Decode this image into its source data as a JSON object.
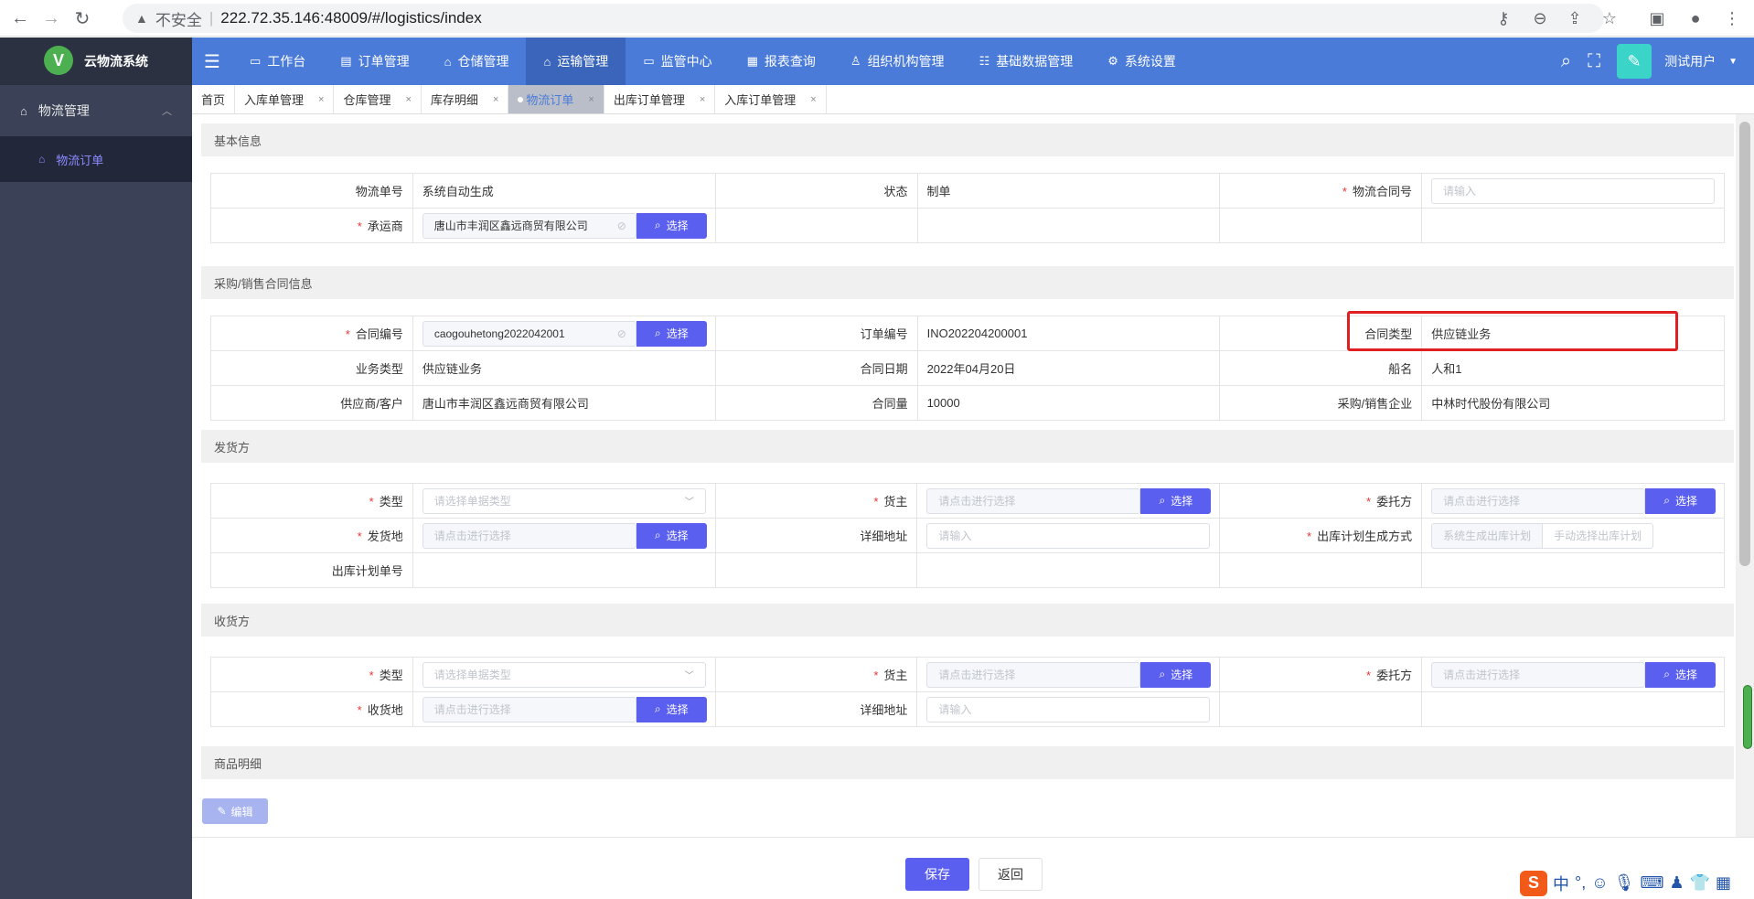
{
  "browser": {
    "security_label": "不安全",
    "url": "222.72.35.146:48009/#/logistics/index"
  },
  "sidebar": {
    "logo_letter": "V",
    "app_name": "云物流系统",
    "group_label": "物流管理",
    "sub_label": "物流订单"
  },
  "topnav": {
    "items": [
      {
        "label": "工作台",
        "icon": "monitor-icon"
      },
      {
        "label": "订单管理",
        "icon": "document-icon"
      },
      {
        "label": "仓储管理",
        "icon": "home-icon"
      },
      {
        "label": "运输管理",
        "icon": "home-icon"
      },
      {
        "label": "监管中心",
        "icon": "monitor-icon"
      },
      {
        "label": "报表查询",
        "icon": "chart-icon"
      },
      {
        "label": "组织机构管理",
        "icon": "org-icon"
      },
      {
        "label": "基础数据管理",
        "icon": "list-icon"
      },
      {
        "label": "系统设置",
        "icon": "gear-icon"
      }
    ],
    "user_name": "测试用户"
  },
  "tabs": [
    {
      "label": "首页",
      "closable": false
    },
    {
      "label": "入库单管理",
      "closable": true
    },
    {
      "label": "仓库管理",
      "closable": true
    },
    {
      "label": "库存明细",
      "closable": true
    },
    {
      "label": "物流订单",
      "closable": true,
      "active": true
    },
    {
      "label": "出库订单管理",
      "closable": true
    },
    {
      "label": "入库订单管理",
      "closable": true
    }
  ],
  "sections": {
    "basic": "基本信息",
    "contract": "采购/销售合同信息",
    "shipper": "发货方",
    "receiver": "收货方",
    "goods": "商品明细"
  },
  "basic": {
    "order_no_label": "物流单号",
    "order_no_value": "系统自动生成",
    "status_label": "状态",
    "status_value": "制单",
    "contract_no_label": "物流合同号",
    "contract_no_placeholder": "请输入",
    "carrier_label": "承运商",
    "carrier_value": "唐山市丰润区鑫远商贸有限公司"
  },
  "contract": {
    "contract_code_label": "合同编号",
    "contract_code_value": "caogouhetong2022042001",
    "order_code_label": "订单编号",
    "order_code_value": "INO202204200001",
    "contract_type_label": "合同类型",
    "contract_type_value": "供应链业务",
    "biz_type_label": "业务类型",
    "biz_type_value": "供应链业务",
    "contract_date_label": "合同日期",
    "contract_date_value": "2022年04月20日",
    "ship_name_label": "船名",
    "ship_name_value": "人和1",
    "supplier_label": "供应商/客户",
    "supplier_value": "唐山市丰润区鑫远商贸有限公司",
    "quantity_label": "合同量",
    "quantity_value": "10000",
    "company_label": "采购/销售企业",
    "company_value": "中林时代股份有限公司"
  },
  "shipper": {
    "type_label": "类型",
    "type_placeholder": "请选择单据类型",
    "owner_label": "货主",
    "owner_placeholder": "请点击进行选择",
    "client_label": "委托方",
    "client_placeholder": "请点击进行选择",
    "origin_label": "发货地",
    "origin_placeholder": "请点击进行选择",
    "address_label": "详细地址",
    "address_placeholder": "请输入",
    "plan_mode_label": "出库计划生成方式",
    "plan_mode_options": [
      "系统生成出库计划",
      "手动选择出库计划"
    ],
    "plan_no_label": "出库计划单号"
  },
  "receiver": {
    "type_label": "类型",
    "type_placeholder": "请选择单据类型",
    "owner_label": "货主",
    "owner_placeholder": "请点击进行选择",
    "client_label": "委托方",
    "client_placeholder": "请点击进行选择",
    "dest_label": "收货地",
    "dest_placeholder": "请点击进行选择",
    "address_label": "详细地址",
    "address_placeholder": "请输入"
  },
  "buttons": {
    "select": "选择",
    "edit": "编辑",
    "save": "保存",
    "back": "返回"
  },
  "ime": {
    "logo": "S",
    "mode": "中"
  },
  "colors": {
    "primary": "#5b5ff0",
    "nav_bg": "#4a7bd8",
    "sidebar_bg": "#3b4257",
    "highlight": "#e02020"
  }
}
